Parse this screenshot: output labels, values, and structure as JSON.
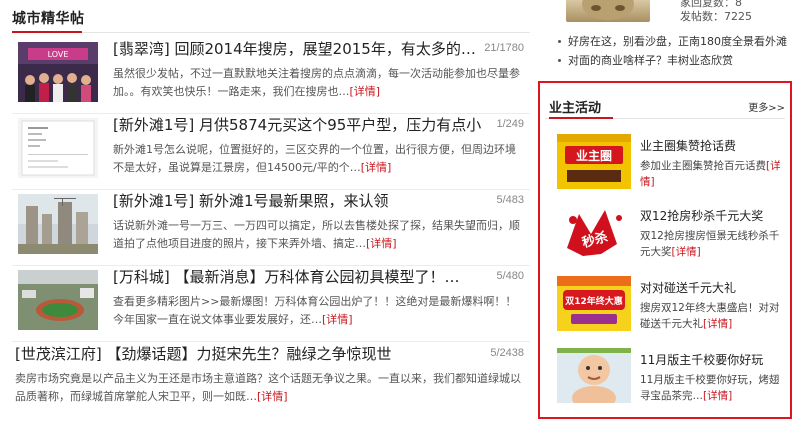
{
  "city_posts": {
    "heading": "城市精华帖",
    "detail_label": "[详情]",
    "posts": [
      {
        "title": "[翡翠湾] 回顾2014年搜房，展望2015年，有太多的…",
        "count": "21/1780",
        "summary": "虽然很少发帖，不过一直默默地关注着搜房的点点滴滴，每一次活动能参加也尽量参加。。有欢笑也快乐！一路走来，我们在搜房也…",
        "thumb_icon": "event-stage-photo"
      },
      {
        "title": "[新外滩1号] 月供5874元买这个95平户型，压力有点小",
        "count": "1/249",
        "summary": "新外滩1号怎么说呢，位置挺好的，三区交界的一个位置，出行很方便，但周边环境不是太好，虽说算是江景房，但14500元/平的个…",
        "thumb_icon": "floor-plan-document"
      },
      {
        "title": "[新外滩1号] 新外滩1号最新果照，来认领",
        "count": "5/483",
        "summary": "话说新外滩一号一万三、一万四可以搞定，所以去售楼处探了探，结果失望而归，顺道拍了点他项目进度的照片，接下来弄外墙、搞定…",
        "thumb_icon": "construction-site-photo"
      },
      {
        "title": "[万科城] 【最新消息】万科体育公园初具模型了！…",
        "count": "5/480",
        "summary": "查看更多精彩图片>>最新爆图！万科体育公园出炉了！！这绝对是最新爆料啊！！今年国家一直在说文体事业要发展好，还…",
        "thumb_icon": "sports-park-aerial-photo"
      },
      {
        "title": "[世茂滨江府] 【劲爆话题】力挺宋先生？融绿之争惊现世",
        "count": "5/2438",
        "summary": "卖房市场究竟是以产品主义为王还是市场主意道路？这个话题无争议之果。一直以来，我们都知道绿城以品质著称，而绿城首席掌舵人宋卫平，则一如既…",
        "thumb_icon": ""
      }
    ]
  },
  "user_info": {
    "stat_top": "家回复数：8",
    "post_count": "发帖数：7225"
  },
  "news": [
    "好房在这，别看沙盘，正南180度全景看外滩",
    "对面的商业啥样子？丰树业态欣赏"
  ],
  "owner_activity": {
    "heading": "业主活动",
    "more_label": "更多>>",
    "detail_label": "[详情]",
    "items": [
      {
        "title": "业主圈集赞抢话费",
        "summary": "参加业主圈集赞抢百元话费",
        "thumb_text": "业主圈",
        "thumb_icon": "owner-circle-banner"
      },
      {
        "title": "双12抢房秒杀千元大奖",
        "summary": "双12抢房搜房恒景无线秒杀千元大奖",
        "thumb_text": "秒杀",
        "thumb_icon": "flash-sale-banner"
      },
      {
        "title": "对对碰送千元大礼",
        "summary": "搜房双12年终大惠盛启！对对碰送千元大礼",
        "thumb_text": "双12年终大惠",
        "thumb_icon": "double12-promo-banner"
      },
      {
        "title": "11月版主千校要你好玩",
        "summary": "11月版主千校要你好玩，烤翅寻宝品茶完…",
        "thumb_text": "",
        "thumb_icon": "child-photo"
      }
    ]
  },
  "colors": {
    "accent_red": "#c8161d",
    "highlight_border": "#e0141e"
  }
}
